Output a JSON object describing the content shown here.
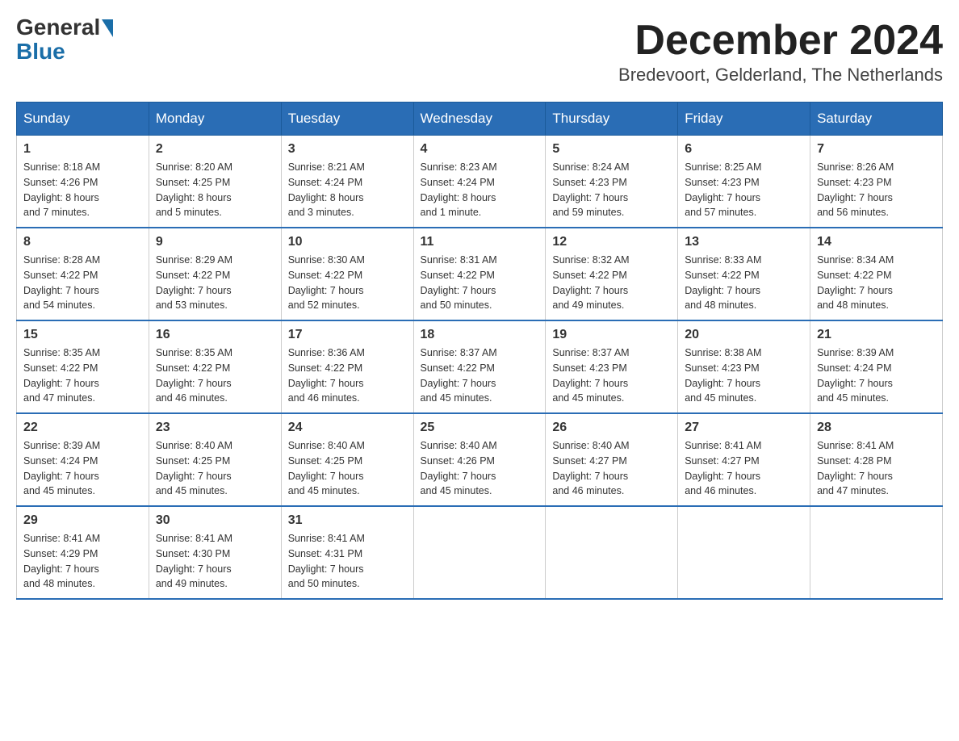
{
  "logo": {
    "general": "General",
    "blue": "Blue"
  },
  "title": "December 2024",
  "subtitle": "Bredevoort, Gelderland, The Netherlands",
  "days_of_week": [
    "Sunday",
    "Monday",
    "Tuesday",
    "Wednesday",
    "Thursday",
    "Friday",
    "Saturday"
  ],
  "weeks": [
    [
      {
        "day": "1",
        "sunrise": "8:18 AM",
        "sunset": "4:26 PM",
        "daylight": "8 hours and 7 minutes."
      },
      {
        "day": "2",
        "sunrise": "8:20 AM",
        "sunset": "4:25 PM",
        "daylight": "8 hours and 5 minutes."
      },
      {
        "day": "3",
        "sunrise": "8:21 AM",
        "sunset": "4:24 PM",
        "daylight": "8 hours and 3 minutes."
      },
      {
        "day": "4",
        "sunrise": "8:23 AM",
        "sunset": "4:24 PM",
        "daylight": "8 hours and 1 minute."
      },
      {
        "day": "5",
        "sunrise": "8:24 AM",
        "sunset": "4:23 PM",
        "daylight": "7 hours and 59 minutes."
      },
      {
        "day": "6",
        "sunrise": "8:25 AM",
        "sunset": "4:23 PM",
        "daylight": "7 hours and 57 minutes."
      },
      {
        "day": "7",
        "sunrise": "8:26 AM",
        "sunset": "4:23 PM",
        "daylight": "7 hours and 56 minutes."
      }
    ],
    [
      {
        "day": "8",
        "sunrise": "8:28 AM",
        "sunset": "4:22 PM",
        "daylight": "7 hours and 54 minutes."
      },
      {
        "day": "9",
        "sunrise": "8:29 AM",
        "sunset": "4:22 PM",
        "daylight": "7 hours and 53 minutes."
      },
      {
        "day": "10",
        "sunrise": "8:30 AM",
        "sunset": "4:22 PM",
        "daylight": "7 hours and 52 minutes."
      },
      {
        "day": "11",
        "sunrise": "8:31 AM",
        "sunset": "4:22 PM",
        "daylight": "7 hours and 50 minutes."
      },
      {
        "day": "12",
        "sunrise": "8:32 AM",
        "sunset": "4:22 PM",
        "daylight": "7 hours and 49 minutes."
      },
      {
        "day": "13",
        "sunrise": "8:33 AM",
        "sunset": "4:22 PM",
        "daylight": "7 hours and 48 minutes."
      },
      {
        "day": "14",
        "sunrise": "8:34 AM",
        "sunset": "4:22 PM",
        "daylight": "7 hours and 48 minutes."
      }
    ],
    [
      {
        "day": "15",
        "sunrise": "8:35 AM",
        "sunset": "4:22 PM",
        "daylight": "7 hours and 47 minutes."
      },
      {
        "day": "16",
        "sunrise": "8:35 AM",
        "sunset": "4:22 PM",
        "daylight": "7 hours and 46 minutes."
      },
      {
        "day": "17",
        "sunrise": "8:36 AM",
        "sunset": "4:22 PM",
        "daylight": "7 hours and 46 minutes."
      },
      {
        "day": "18",
        "sunrise": "8:37 AM",
        "sunset": "4:22 PM",
        "daylight": "7 hours and 45 minutes."
      },
      {
        "day": "19",
        "sunrise": "8:37 AM",
        "sunset": "4:23 PM",
        "daylight": "7 hours and 45 minutes."
      },
      {
        "day": "20",
        "sunrise": "8:38 AM",
        "sunset": "4:23 PM",
        "daylight": "7 hours and 45 minutes."
      },
      {
        "day": "21",
        "sunrise": "8:39 AM",
        "sunset": "4:24 PM",
        "daylight": "7 hours and 45 minutes."
      }
    ],
    [
      {
        "day": "22",
        "sunrise": "8:39 AM",
        "sunset": "4:24 PM",
        "daylight": "7 hours and 45 minutes."
      },
      {
        "day": "23",
        "sunrise": "8:40 AM",
        "sunset": "4:25 PM",
        "daylight": "7 hours and 45 minutes."
      },
      {
        "day": "24",
        "sunrise": "8:40 AM",
        "sunset": "4:25 PM",
        "daylight": "7 hours and 45 minutes."
      },
      {
        "day": "25",
        "sunrise": "8:40 AM",
        "sunset": "4:26 PM",
        "daylight": "7 hours and 45 minutes."
      },
      {
        "day": "26",
        "sunrise": "8:40 AM",
        "sunset": "4:27 PM",
        "daylight": "7 hours and 46 minutes."
      },
      {
        "day": "27",
        "sunrise": "8:41 AM",
        "sunset": "4:27 PM",
        "daylight": "7 hours and 46 minutes."
      },
      {
        "day": "28",
        "sunrise": "8:41 AM",
        "sunset": "4:28 PM",
        "daylight": "7 hours and 47 minutes."
      }
    ],
    [
      {
        "day": "29",
        "sunrise": "8:41 AM",
        "sunset": "4:29 PM",
        "daylight": "7 hours and 48 minutes."
      },
      {
        "day": "30",
        "sunrise": "8:41 AM",
        "sunset": "4:30 PM",
        "daylight": "7 hours and 49 minutes."
      },
      {
        "day": "31",
        "sunrise": "8:41 AM",
        "sunset": "4:31 PM",
        "daylight": "7 hours and 50 minutes."
      },
      null,
      null,
      null,
      null
    ]
  ],
  "labels": {
    "sunrise": "Sunrise:",
    "sunset": "Sunset:",
    "daylight": "Daylight:"
  }
}
